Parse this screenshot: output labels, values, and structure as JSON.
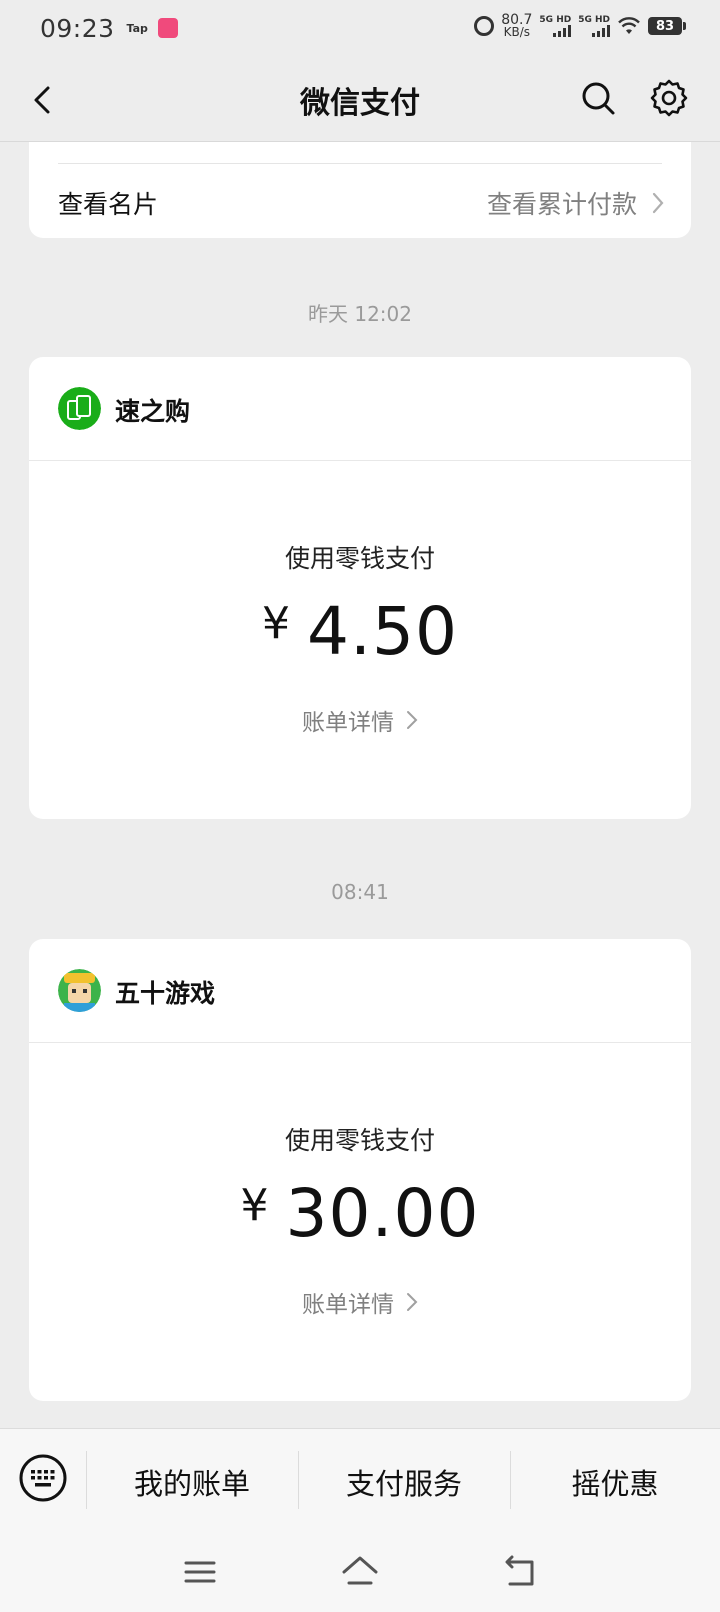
{
  "status_bar": {
    "time": "09:23",
    "tap_label": "Tap",
    "net_speed_value": "80.7",
    "net_speed_unit": "KB/s",
    "sim1_label": "5G HD",
    "sim2_label": "5G HD",
    "battery": "83"
  },
  "nav": {
    "title": "微信支付"
  },
  "top_card": {
    "left_link": "查看名片",
    "right_link": "查看累计付款"
  },
  "payments": [
    {
      "timestamp": "昨天 12:02",
      "merchant": "速之购",
      "method": "使用零钱支付",
      "currency": "¥",
      "amount": "4.50",
      "detail_label": "账单详情"
    },
    {
      "timestamp": "08:41",
      "merchant": "五十游戏",
      "method": "使用零钱支付",
      "currency": "¥",
      "amount": "30.00",
      "detail_label": "账单详情"
    }
  ],
  "bottom_menu": {
    "items": [
      "我的账单",
      "支付服务",
      "摇优惠"
    ]
  },
  "icons": {
    "back": "chevron-left-icon",
    "search": "search-icon",
    "settings": "gear-icon",
    "keyboard": "keyboard-icon",
    "merchant1_logo": "green-phone-logo",
    "merchant2_logo": "game-avatar-logo"
  },
  "colors": {
    "background": "#ededed",
    "card": "#ffffff",
    "secondary_text": "#808080",
    "merchant1_logo": "#1aad19"
  }
}
